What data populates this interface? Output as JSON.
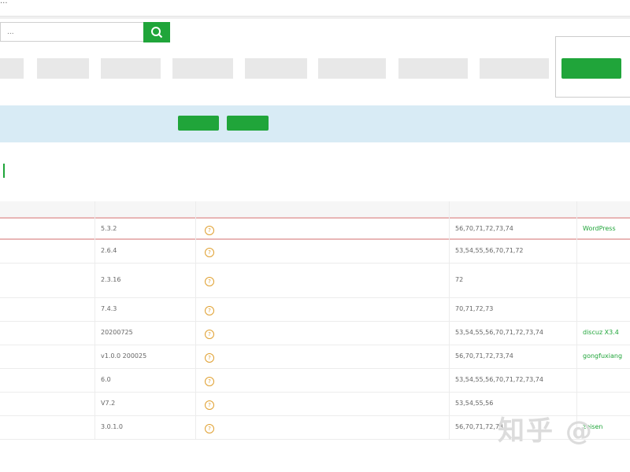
{
  "top": {
    "title": "..."
  },
  "search": {
    "placeholder": "..."
  },
  "categories": [
    "",
    "",
    "",
    "",
    "",
    "",
    "",
    ""
  ],
  "oneclick_label": "",
  "notice": {
    "text": "",
    "btn_existing": "",
    "btn_import": ""
  },
  "tabs": [
    "",
    "",
    "",
    "",
    "",
    ""
  ],
  "table": {
    "headers": [
      "",
      "",
      "",
      ""
    ],
    "rows": [
      {
        "name": "",
        "version": "5.3.2",
        "desc": "",
        "php": "56,70,71,72,73,74",
        "provider": "WordPress",
        "h": 27
      },
      {
        "name": "",
        "version": "2.6.4",
        "desc": "",
        "php": "53,54,55,56,70,71,72",
        "provider": "",
        "h": 30
      },
      {
        "name": "",
        "version": "2.3.16",
        "desc": "",
        "php": "72",
        "provider": "",
        "h": 44
      },
      {
        "name": "",
        "version": "7.4.3",
        "desc": "",
        "php": "70,71,72,73",
        "provider": "",
        "h": 30
      },
      {
        "name": "",
        "version": "20200725",
        "desc": "",
        "php": "53,54,55,56,70,71,72,73,74",
        "provider": "discuz X3.4",
        "h": 30
      },
      {
        "name": "",
        "version": "v1.0.0 200025",
        "desc": "",
        "php": "56,70,71,72,73,74",
        "provider": "gongfuxiang",
        "h": 30
      },
      {
        "name": "",
        "version": "6.0",
        "desc": "",
        "php": "53,54,55,56,70,71,72,73,74",
        "provider": "",
        "h": 30
      },
      {
        "name": "",
        "version": "V7.2",
        "desc": "",
        "php": "53,54,55,56",
        "provider": "",
        "h": 30
      },
      {
        "name": "",
        "version": "3.0.1.0",
        "desc": "",
        "php": "56,70,71,72,73",
        "provider": "zeisen",
        "h": 30
      }
    ]
  },
  "watermark": "知乎 @",
  "colors": {
    "accent": "#20a53a",
    "notice_bg": "#d8ebf5",
    "highlight_border": "#e8b6b6",
    "help_icon": "#e0a030"
  },
  "icons": {
    "search": "search-icon",
    "help": "help-icon"
  }
}
